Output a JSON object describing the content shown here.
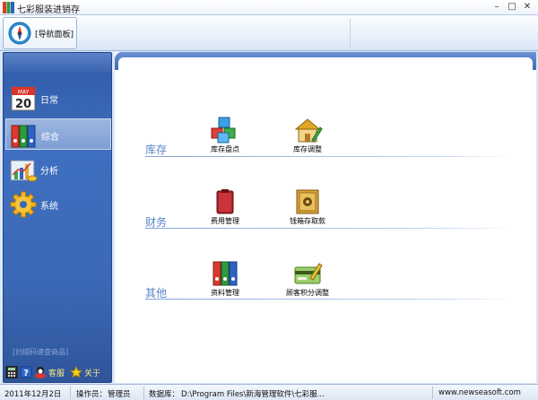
{
  "window": {
    "title": "七彩服装进销存",
    "buttons": [
      "–",
      "□",
      "✕"
    ]
  },
  "ribbon": {
    "nav_tab_label": "[导航面板]"
  },
  "sidebar": {
    "items": [
      {
        "label": "日常",
        "icon": "calendar-icon",
        "calendar_month": "MAY",
        "calendar_day": "20"
      },
      {
        "label": "综合",
        "icon": "binders-icon",
        "active": true
      },
      {
        "label": "分析",
        "icon": "chart-icon"
      },
      {
        "label": "系统",
        "icon": "gear-icon"
      }
    ],
    "scan_hint": "[扫描码速查商品]",
    "bottom": {
      "service_label": "客服",
      "about_label": "关于"
    }
  },
  "main": {
    "sections": [
      {
        "title": "库存",
        "tools": [
          {
            "label": "库存盘点",
            "icon": "cubes-icon"
          },
          {
            "label": "库存调整",
            "icon": "house-edit-icon"
          }
        ]
      },
      {
        "title": "财务",
        "tools": [
          {
            "label": "费用管理",
            "icon": "wallet-icon"
          },
          {
            "label": "钱箱存取款",
            "icon": "safe-icon"
          }
        ]
      },
      {
        "title": "其他",
        "tools": [
          {
            "label": "资料管理",
            "icon": "binders-icon"
          },
          {
            "label": "顾客积分调整",
            "icon": "credit-card-icon"
          }
        ]
      }
    ]
  },
  "statusbar": {
    "date": "2011年12月2日",
    "operator_label": "操作员：",
    "operator": "管理员",
    "database_label": "数据库：",
    "database_path": "D:\\Program Files\\新海管理软件\\七彩服...",
    "website": "www.newseasoft.com"
  },
  "colors": {
    "sidebar_blue": "#3f6fc0",
    "section_title": "#5a86c6"
  }
}
